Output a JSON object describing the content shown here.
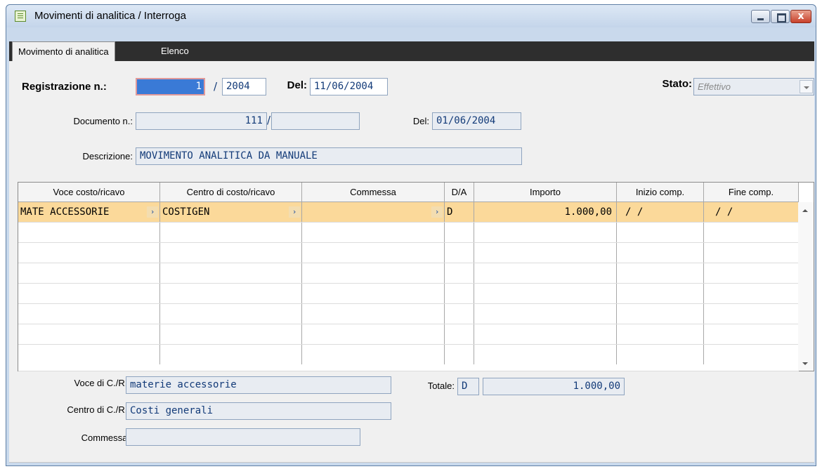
{
  "window": {
    "title": "Movimenti di analitica / Interroga",
    "close_label": "x"
  },
  "tabs": [
    {
      "label": "Movimento di analitica"
    },
    {
      "label": "Elenco"
    }
  ],
  "header": {
    "registrazione_label": "Registrazione n.:",
    "registrazione_value": "1",
    "separator": "/",
    "anno_value": "2004",
    "del_label": "Del:",
    "del_value": "11/06/2004",
    "stato_label": "Stato:",
    "stato_value": "Effettivo",
    "documento_label": "Documento n.:",
    "documento_value": "111",
    "documento_separator": "/",
    "documento_serie_value": "",
    "documento_del_label": "Del:",
    "documento_del_value": "01/06/2004",
    "descrizione_label": "Descrizione:",
    "descrizione_value": "MOVIMENTO ANALITICA DA MANUALE"
  },
  "grid": {
    "columns": [
      "Voce costo/ricavo",
      "Centro di costo/ricavo",
      "Commessa",
      "D/A",
      "Importo",
      "Inizio comp.",
      "Fine comp."
    ],
    "rows": [
      {
        "voce": "MATE ACCESSORIE",
        "centro": "COSTIGEN",
        "commessa": "",
        "da": "D",
        "importo": "1.000,00",
        "inizio": "/ /",
        "fine": "/ /"
      }
    ],
    "zoom_glyph": "›"
  },
  "footer": {
    "voce_label": "Voce di C./R.:",
    "voce_value": "materie accessorie",
    "centro_label": "Centro di C./R.:",
    "centro_value": "Costi generali",
    "commessa_label": "Commessa:",
    "commessa_value": "",
    "totale_label": "Totale:",
    "totale_da": "D",
    "totale_value": "1.000,00"
  },
  "icons": [
    "app-icon",
    "minimize-icon",
    "maximize-icon",
    "close-icon",
    "zoom-arrow-icon",
    "dropdown-arrow-icon",
    "scroll-up-icon",
    "scroll-down-icon"
  ]
}
